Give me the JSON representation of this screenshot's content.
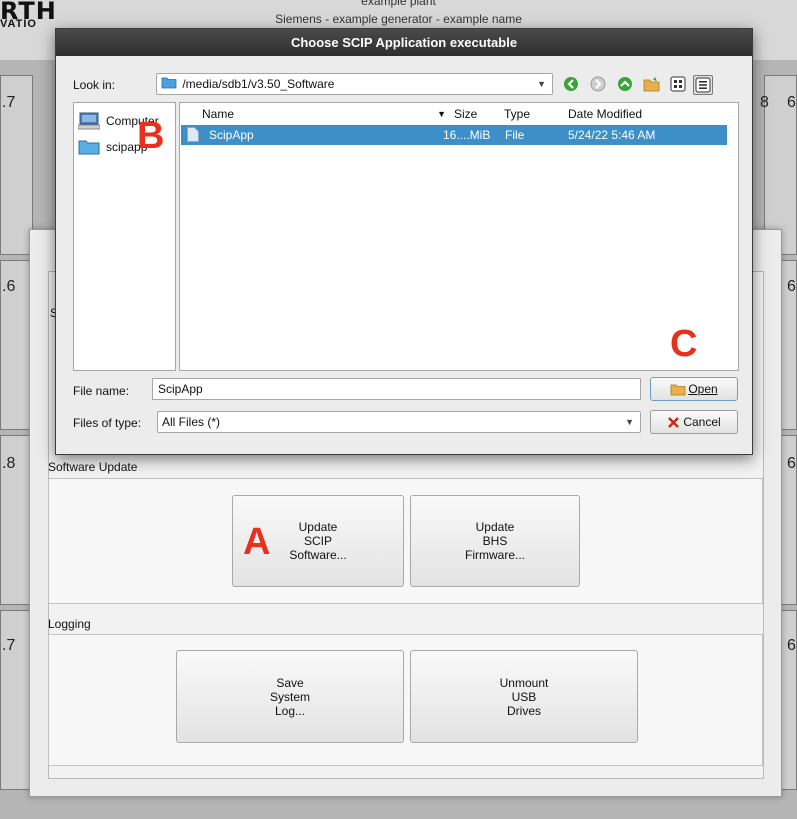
{
  "background": {
    "logo": "RTH",
    "logo_sub": "VATIO",
    "header_line1": "example plant",
    "header_line2": "Siemens - example generator - example name",
    "row_numbers_left": [
      ".7",
      ".6",
      ".8",
      ".7"
    ],
    "row_numbers_right": [
      "6",
      "6",
      "6",
      "6"
    ],
    "col_number": "8"
  },
  "dialog": {
    "title": "Choose SCIP Application executable",
    "look_in_label": "Look in:",
    "look_in_value": "/media/sdb1/v3.50_Software",
    "toolbar_icons": [
      "back-icon",
      "forward-icon",
      "parent-dir-icon",
      "new-folder-icon",
      "list-view-icon",
      "detail-view-icon"
    ],
    "sidebar": [
      {
        "label": "Computer",
        "icon": "computer-icon"
      },
      {
        "label": "scipapp",
        "icon": "folder-icon"
      }
    ],
    "columns": [
      "Name",
      "Size",
      "Type",
      "Date Modified"
    ],
    "files": [
      {
        "name": "ScipApp",
        "size": "16....MiB",
        "type": "File",
        "date": "5/24/22 5:46 AM",
        "selected": true
      }
    ],
    "file_name_label": "File name:",
    "file_name_value": "ScipApp",
    "files_of_type_label": "Files of type:",
    "files_of_type_value": "All Files (*)",
    "open_label": "Open",
    "cancel_label": "Cancel"
  },
  "panel": {
    "software_update_label": "Software Update",
    "update_scip_label": "Update\nSCIP\nSoftware...",
    "update_bhs_label": "Update\nBHS\nFirmware...",
    "logging_label": "Logging",
    "save_log_label": "Save\nSystem\nLog...",
    "unmount_label": "Unmount\nUSB\nDrives",
    "truncated_label": "S"
  },
  "annotations": {
    "a": "A",
    "b": "B",
    "c": "C"
  },
  "colors": {
    "annotation": "#e8301c",
    "selection": "#3c8fc7",
    "titlebar": "#3a3a3a"
  }
}
